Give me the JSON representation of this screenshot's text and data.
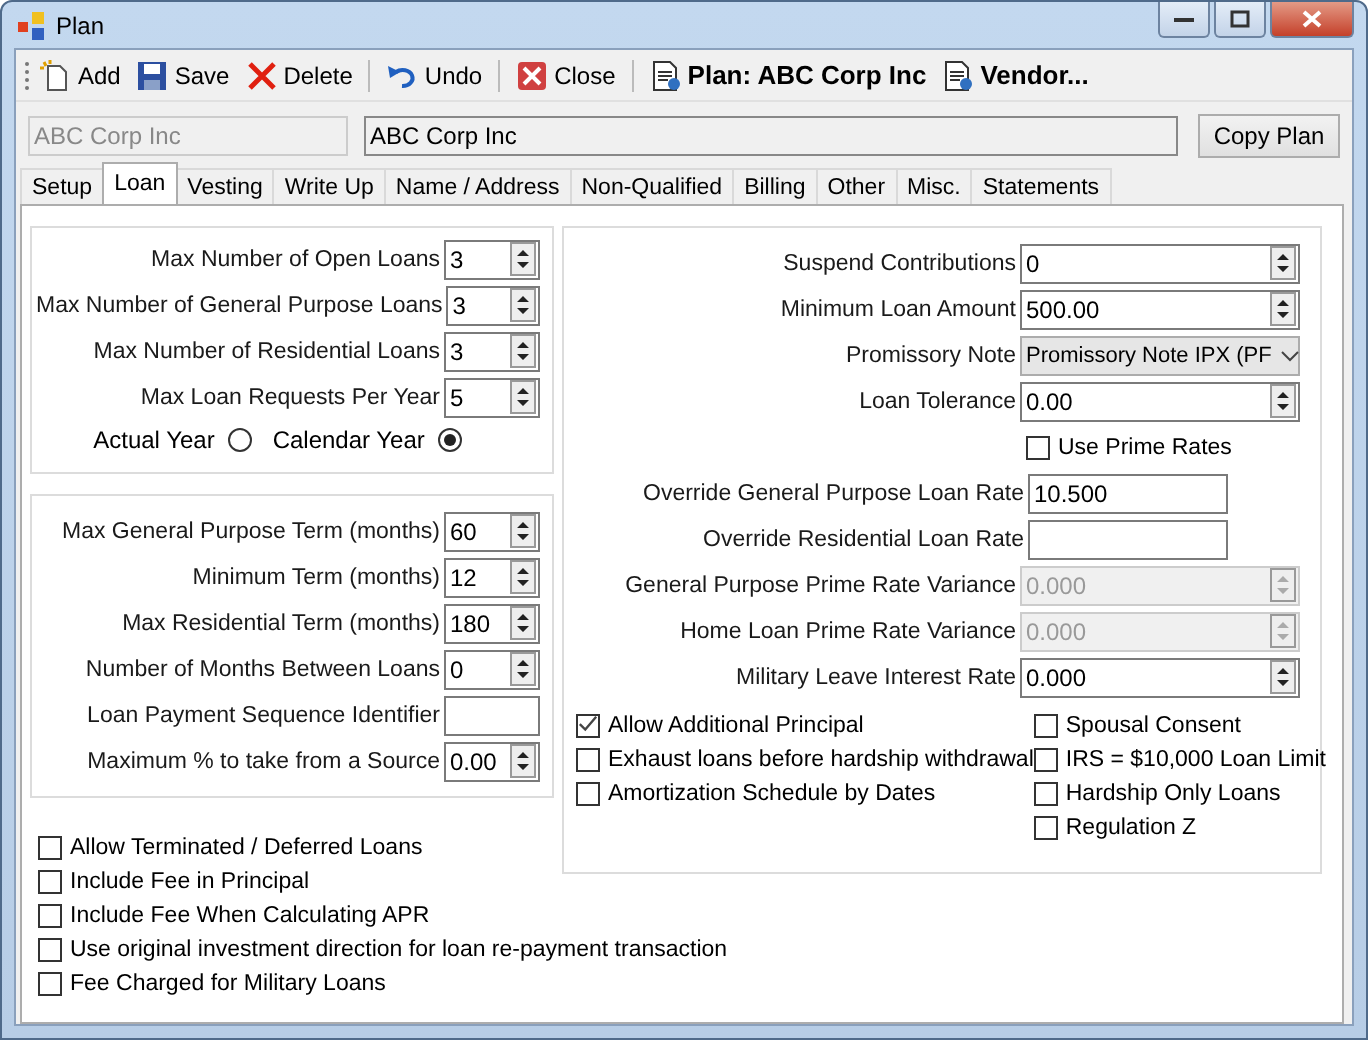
{
  "window": {
    "title": "Plan"
  },
  "toolbar": [
    {
      "kind": "add",
      "label": "Add"
    },
    {
      "kind": "save",
      "label": "Save"
    },
    {
      "kind": "delete",
      "label": "Delete"
    },
    {
      "kind": "undo",
      "label": "Undo"
    },
    {
      "kind": "close",
      "label": "Close"
    },
    {
      "kind": "doc",
      "label": "Plan: ABC Corp Inc"
    },
    {
      "kind": "doc",
      "label": "Vendor..."
    }
  ],
  "plan_code": {
    "value": "ABC Corp Inc",
    "disabled": true
  },
  "plan_name": {
    "value": "ABC Corp Inc"
  },
  "copy_button": "Copy Plan",
  "tabs": [
    {
      "label": "Setup",
      "selected": false
    },
    {
      "label": "Loan",
      "selected": true
    },
    {
      "label": "Vesting",
      "selected": false
    },
    {
      "label": "Write Up",
      "selected": false
    },
    {
      "label": "Name / Address",
      "selected": false
    },
    {
      "label": "Non-Qualified",
      "selected": false
    },
    {
      "label": "Billing",
      "selected": false
    },
    {
      "label": "Other",
      "selected": false
    },
    {
      "label": "Misc.",
      "selected": false
    },
    {
      "label": "Statements",
      "selected": false
    }
  ],
  "loan_limits": {
    "fields": [
      {
        "kind": "spin",
        "label": "Max Number of Open Loans",
        "value": "3",
        "disabled": false
      },
      {
        "kind": "spin",
        "label": "Max Number of General Purpose Loans",
        "value": "3",
        "disabled": false
      },
      {
        "kind": "spin",
        "label": "Max Number of Residential Loans",
        "value": "3",
        "disabled": false
      },
      {
        "kind": "spin",
        "label": "Max Loan Requests Per Year",
        "value": "5",
        "disabled": false
      }
    ],
    "year_options": [
      {
        "label": "Actual Year",
        "selected": false
      },
      {
        "label": "Calendar Year",
        "selected": true
      }
    ]
  },
  "loan_terms": {
    "fields": [
      {
        "kind": "spin",
        "label": "Max General Purpose Term (months)",
        "value": "60",
        "disabled": false
      },
      {
        "kind": "spin",
        "label": "Minimum Term (months)",
        "value": "12",
        "disabled": false
      },
      {
        "kind": "spin",
        "label": "Max Residential Term (months)",
        "value": "180",
        "disabled": false
      },
      {
        "kind": "spin",
        "label": "Number of Months Between Loans",
        "value": "0",
        "disabled": false
      },
      {
        "kind": "text",
        "label": "Loan Payment Sequence Identifier",
        "disabled": false
      },
      {
        "kind": "spin",
        "label": "Maximum % to take from a Source",
        "value": "0.00",
        "disabled": false
      }
    ]
  },
  "loan_options": [
    {
      "label": "Allow Terminated / Deferred Loans",
      "checked": false
    },
    {
      "label": "Include Fee in Principal",
      "checked": false
    },
    {
      "label": "Include Fee When Calculating APR",
      "checked": false
    },
    {
      "label": "Use original investment direction for loan re-payment transaction",
      "checked": false
    },
    {
      "label": "Fee Charged for Military Loans",
      "checked": false
    }
  ],
  "loan_rates": {
    "fields": [
      {
        "kind": "spin",
        "label": "Suspend Contributions",
        "value": "0",
        "disabled": false
      },
      {
        "kind": "spin",
        "label": "Minimum Loan Amount",
        "value": "500.00",
        "disabled": false
      },
      {
        "kind": "combo",
        "label": "Promissory Note",
        "value": "Promissory Note IPX (PF",
        "disabled": false
      },
      {
        "kind": "spin",
        "label": "Loan Tolerance",
        "value": "0.00",
        "disabled": false
      },
      {
        "kind": "checkbox",
        "label": "Use Prime Rates",
        "checked": false
      },
      {
        "kind": "text",
        "label": "Override General Purpose Loan Rate",
        "value": "10.500",
        "disabled": false
      },
      {
        "kind": "text",
        "label": "Override Residential Loan Rate",
        "disabled": false
      },
      {
        "kind": "spin",
        "label": "General Purpose Prime Rate Variance",
        "value": "0.000",
        "disabled": true
      },
      {
        "kind": "spin",
        "label": "Home Loan Prime Rate Variance",
        "value": "0.000",
        "disabled": true
      },
      {
        "kind": "spin",
        "label": "Military Leave Interest Rate",
        "value": "0.000",
        "disabled": false
      }
    ],
    "options_left": [
      {
        "label": "Allow Additional Principal",
        "checked": true
      },
      {
        "label": "Exhaust loans before hardship withdrawal",
        "checked": false
      },
      {
        "label": "Amortization Schedule by Dates",
        "checked": false
      }
    ],
    "options_right": [
      {
        "label": "Spousal Consent",
        "checked": false
      },
      {
        "label": "IRS = $10,000 Loan Limit",
        "checked": false
      },
      {
        "label": "Hardship Only Loans",
        "checked": false
      },
      {
        "label": "Regulation Z",
        "checked": false
      }
    ]
  }
}
